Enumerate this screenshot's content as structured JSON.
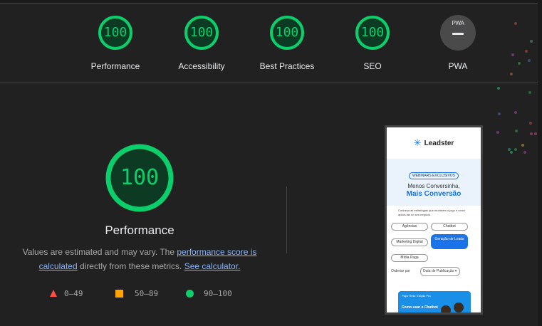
{
  "gauges": [
    {
      "label": "Performance",
      "score": "100"
    },
    {
      "label": "Accessibility",
      "score": "100"
    },
    {
      "label": "Best Practices",
      "score": "100"
    },
    {
      "label": "SEO",
      "score": "100"
    },
    {
      "label": "PWA",
      "badge": "PWA"
    }
  ],
  "main": {
    "score": "100",
    "title": "Performance",
    "desc_prefix": "Values are estimated and may vary. The ",
    "desc_link1": "performance score is calculated",
    "desc_middle": " directly from these metrics. ",
    "desc_link2": "See calculator."
  },
  "legend": {
    "fail": "0–49",
    "average": "50–89",
    "pass": "90–100"
  },
  "colors": {
    "pass": "#0cce6b",
    "average": "#ffa400",
    "fail": "#ff4e42",
    "link": "#8ab4f8",
    "background": "#212121"
  },
  "screenshot": {
    "brand": "Leadster",
    "pill": "WEBINARS EXCLUSIVOS",
    "headline": "Menos Conversinha,",
    "headline_accent": "Mais Conversão",
    "subtext": "Conheça as estratégias que mudaram o jogo e como aplicá-las no seu negócio",
    "tags": [
      "Agências",
      "Chatbot",
      "Marketing Digital",
      "Geração de Leads",
      "Mídia Paga"
    ],
    "order_label": "Ordenar por",
    "order_value": "Data de Publicação",
    "card_top": "Papo Reto: Edição Pro",
    "card_title": "Como usar o Chatbot"
  }
}
